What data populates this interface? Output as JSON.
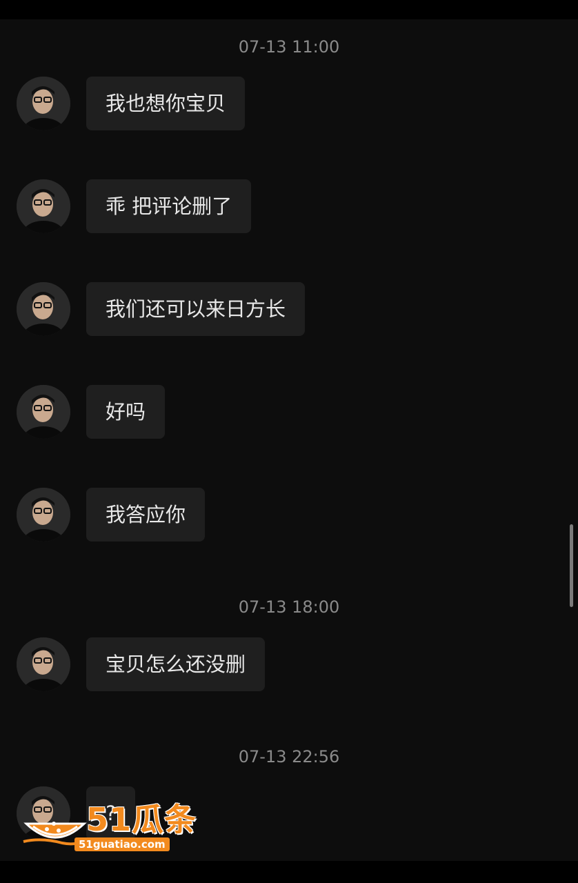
{
  "timestamps": [
    "07-13 11:00",
    "07-13 18:00",
    "07-13 22:56"
  ],
  "messages": [
    {
      "text": "我也想你宝贝"
    },
    {
      "text": "乖 把评论删了"
    },
    {
      "text": "我们还可以来日方长"
    },
    {
      "text": "好吗"
    },
    {
      "text": "我答应你"
    },
    {
      "text": "宝贝怎么还没删"
    },
    {
      "text": "?"
    }
  ],
  "watermark": {
    "brand": "51瓜条",
    "url": "51guatiao.com"
  },
  "colors": {
    "background": "#0d0d0d",
    "bubble": "#1f1f1f",
    "text": "#e8e8e8",
    "timestamp": "#8a8a8a",
    "watermark": "#f28a1e"
  }
}
